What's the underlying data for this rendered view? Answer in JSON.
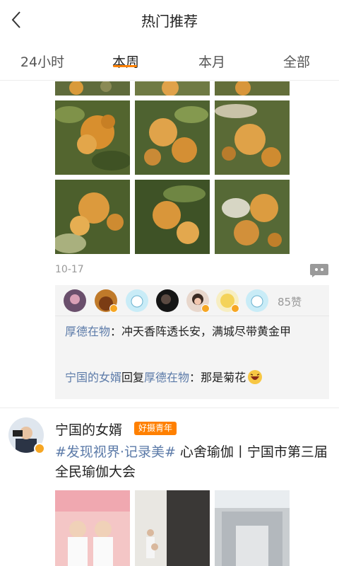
{
  "header": {
    "title": "热门推荐",
    "back_icon": "chevron-left-icon"
  },
  "tabs": [
    {
      "label": "24小时",
      "active": false
    },
    {
      "label": "本周",
      "active": true
    },
    {
      "label": "本月",
      "active": false
    },
    {
      "label": "全部",
      "active": false
    }
  ],
  "accent_color": "#ff8200",
  "link_color": "#5b7aa8",
  "post1": {
    "date": "10-17",
    "like_count": "85赞",
    "comments": [
      {
        "user": "厚德在物",
        "sep": "：",
        "text": "冲天香阵透长安，满城尽带黄金甲"
      },
      {
        "user": "宁国的女婿",
        "reply_word": "回复",
        "reply_to": "厚德在物",
        "sep": "：",
        "text": "那是菊花",
        "emoji": "laughing-emoji"
      }
    ]
  },
  "post2": {
    "author": "宁国的女婿",
    "tag": "好摄青年",
    "hashtag": "#发现视界·记录美#",
    "text": " 心舍瑜伽丨宁国市第三届全民瑜伽大会"
  }
}
